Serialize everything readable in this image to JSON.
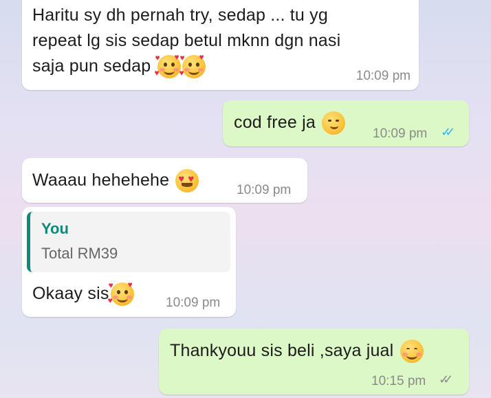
{
  "messages": [
    {
      "direction": "incoming",
      "lines": [
        "Haritu sy dh pernah try, sedap ... tu yg",
        "repeat lg sis sedap betul mknn dgn nasi",
        "saja pun sedap"
      ],
      "emojis": [
        "smiling-face-with-hearts",
        "smiling-face-with-hearts"
      ],
      "time": "10:09 pm"
    },
    {
      "direction": "outgoing",
      "text": "cod free ja",
      "emojis": [
        "smirking-face"
      ],
      "time": "10:09 pm",
      "status": "read"
    },
    {
      "direction": "incoming",
      "text": "Waaau hehehehe",
      "emojis": [
        "heart-eyes-face"
      ],
      "time": "10:09 pm"
    },
    {
      "direction": "incoming",
      "quoted": {
        "author": "You",
        "text": "Total RM39"
      },
      "text": "Okaay sis",
      "emojis": [
        "smiling-face-with-hearts"
      ],
      "time": "10:09 pm"
    },
    {
      "direction": "outgoing",
      "text": "Thankyouu sis beli ,saya jual",
      "emojis": [
        "smiling-face"
      ],
      "time": "10:15 pm",
      "status": "delivered"
    }
  ],
  "ticks_glyph": "✓✓",
  "colors": {
    "incoming_bubble": "#ffffff",
    "outgoing_bubble": "#dcf8c6",
    "read_ticks": "#34b7f1",
    "delivered_ticks": "#8a8a8a",
    "quote_accent": "#0e8a7a"
  }
}
